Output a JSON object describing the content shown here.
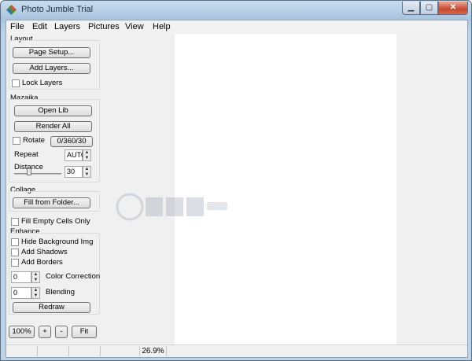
{
  "window": {
    "title": "Photo Jumble Trial"
  },
  "menu": {
    "items": [
      "File",
      "Edit",
      "Layers",
      "Pictures",
      "View",
      "Help"
    ]
  },
  "layout": {
    "label": "Layout",
    "page_setup": "Page Setup...",
    "add_layers": "Add Layers...",
    "lock_layers": "Lock Layers"
  },
  "mazaika": {
    "label": "Mazaika",
    "open_lib": "Open Lib",
    "render_all": "Render All",
    "rotate": "Rotate",
    "rotate_value": "0/360/30",
    "repeat_label": "Repeat",
    "repeat_value": "AUTO",
    "distance_label": "Distance",
    "distance_value": "30"
  },
  "collage": {
    "label": "Collage",
    "fill_from_folder": "Fill from Folder...",
    "fill_empty_cells": "Fill Empty Cells Only"
  },
  "enhance": {
    "label": "Enhance",
    "hide_background": "Hide Background Img",
    "add_shadows": "Add Shadows",
    "add_borders": "Add Borders",
    "color_correction_value": "0",
    "color_correction_label": "Color Correction",
    "blending_value": "0",
    "blending_label": "Blending",
    "redraw": "Redraw"
  },
  "zoom": {
    "reset": "100%",
    "zoom_in": "+",
    "zoom_out": "-",
    "fit": "Fit"
  },
  "status": {
    "zoom_percent": "26.9%"
  },
  "colors": {
    "title_gradient_top": "#c9dcef",
    "close_button": "#c84a2f",
    "panel": "#f0f0f0"
  }
}
